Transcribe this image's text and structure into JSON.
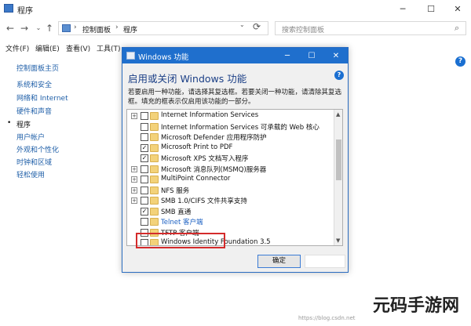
{
  "cp": {
    "title": "程序",
    "controls": {
      "min": "─",
      "max": "☐",
      "close": "✕"
    },
    "nav": {
      "back": "←",
      "forward": "→",
      "recent": "⌄",
      "up": "↑"
    },
    "address": {
      "sep": "›",
      "crumb1": "控制面板",
      "crumb2": "程序",
      "chevron": "⌄",
      "refresh": "⟳"
    },
    "search": {
      "placeholder": "搜索控制面板",
      "icon": "⌕"
    },
    "menu": [
      "文件(F)",
      "编辑(E)",
      "查看(V)",
      "工具(T)"
    ],
    "sidebar": {
      "items": [
        "控制面板主页",
        "系统和安全",
        "网络和 Internet",
        "硬件和声音",
        "程序",
        "用户帐户",
        "外观和个性化",
        "时钟和区域",
        "轻松使用"
      ],
      "current_bullet": "•"
    },
    "help": "?"
  },
  "dialog": {
    "title": "Windows 功能",
    "controls": {
      "min": "─",
      "max": "☐",
      "close": "✕"
    },
    "heading": "启用或关闭 Windows 功能",
    "help": "?",
    "description": "若要启用一种功能，请选择其复选框。若要关闭一种功能，请清除其复选框。填充的框表示仅启用该功能的一部分。",
    "features": [
      {
        "label": "Internet Information Services",
        "expandable": true,
        "checked": false
      },
      {
        "label": "Internet Information Services 可承载的 Web 核心",
        "expandable": false,
        "checked": false
      },
      {
        "label": "Microsoft Defender 应用程序防护",
        "expandable": false,
        "checked": false
      },
      {
        "label": "Microsoft Print to PDF",
        "expandable": false,
        "checked": true
      },
      {
        "label": "Microsoft XPS 文档写入程序",
        "expandable": false,
        "checked": true
      },
      {
        "label": "Microsoft 消息队列(MSMQ)服务器",
        "expandable": true,
        "checked": false
      },
      {
        "label": "MultiPoint Connector",
        "expandable": true,
        "checked": false
      },
      {
        "label": "NFS 服务",
        "expandable": true,
        "checked": false
      },
      {
        "label": "SMB 1.0/CIFS 文件共享支持",
        "expandable": true,
        "checked": false
      },
      {
        "label": "SMB 直通",
        "expandable": false,
        "checked": true
      },
      {
        "label": "Telnet 客户端",
        "expandable": false,
        "checked": false,
        "highlighted": true
      },
      {
        "label": "TFTP 客户端",
        "expandable": false,
        "checked": false
      },
      {
        "label": "Windows Identity Foundation 3.5",
        "expandable": false,
        "checked": false
      }
    ],
    "check_mark": "✓",
    "expander": "+",
    "scroll": {
      "up": "▲",
      "down": "▼"
    },
    "ok_label": "确定"
  },
  "watermark": {
    "logo": "元码手游网",
    "small": "https://blog.csdn.net"
  }
}
